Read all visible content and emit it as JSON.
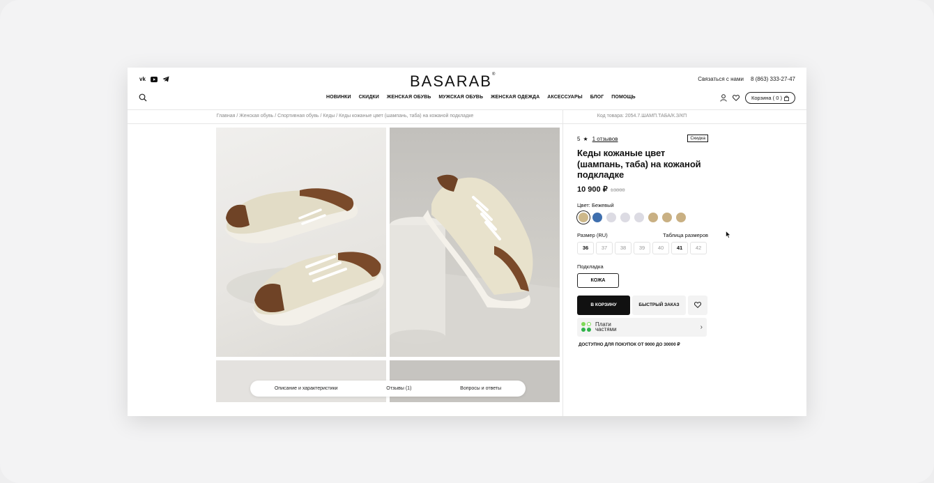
{
  "header": {
    "logo": "BASARAB",
    "logo_mark": "®",
    "social": [
      {
        "icon": "vk-icon",
        "label": "vk"
      },
      {
        "icon": "youtube-icon",
        "label": ""
      },
      {
        "icon": "telegram-icon",
        "label": ""
      }
    ],
    "contact_link": "Связаться с нами",
    "phone": "8 (863) 333-27-47",
    "nav": [
      "НОВИНКИ",
      "СКИДКИ",
      "ЖЕНСКАЯ ОБУВЬ",
      "МУЖСКАЯ ОБУВЬ",
      "ЖЕНСКАЯ ОДЕЖДА",
      "АКСЕССУАРЫ",
      "БЛОГ",
      "ПОМОЩЬ"
    ],
    "cart_label": "Корзина ( 0 )"
  },
  "breadcrumb": "Главная / Женская обувь / Спортивная обувь / Кеды / Кеды кожаные цвет (шампань, таба) на кожаной подкладке",
  "sku": "Код товара: 2054.7.ШАМП.ТАБА/К.З/КП",
  "tabs": [
    "Описание и характеристики",
    "Отзывы (1)",
    "Вопросы и ответы"
  ],
  "product": {
    "rating": "5",
    "star": "★",
    "reviews": "1 отзывов",
    "badge": "Скидка",
    "title": "Кеды кожаные цвет (шампань, таба) на кожаной подкладке",
    "price": "10 900 ₽",
    "old_price": "13800",
    "color_label": "Цвет: Бежевый",
    "swatches": [
      "#cdb88a",
      "#3f6fae",
      "#dcdbe3",
      "#dcdbe3",
      "#dcdbe3",
      "#c9b083",
      "#c9b083",
      "#c9b083"
    ],
    "size_label": "Размер (RU)",
    "size_table": "Таблица размеров",
    "sizes": [
      {
        "v": "36",
        "avail": true
      },
      {
        "v": "37",
        "avail": false
      },
      {
        "v": "38",
        "avail": false
      },
      {
        "v": "39",
        "avail": false
      },
      {
        "v": "40",
        "avail": false
      },
      {
        "v": "41",
        "avail": true
      },
      {
        "v": "42",
        "avail": false
      }
    ],
    "lining_label": "Подкладка",
    "lining_value": "КОЖА",
    "add_to_cart": "В КОРЗИНУ",
    "quick_order": "БЫСТРЫЙ ЗАКАЗ",
    "split_line1": "Плати",
    "split_line2": "частями",
    "split_arrow": "›",
    "split_note": "ДОСТУПНО ДЛЯ ПОКУПОК ОТ 9000 ДО 30000 ₽"
  },
  "colors": {
    "accent": "#111111",
    "split_green": "#7ed957",
    "split_green_dark": "#2fb34a"
  }
}
